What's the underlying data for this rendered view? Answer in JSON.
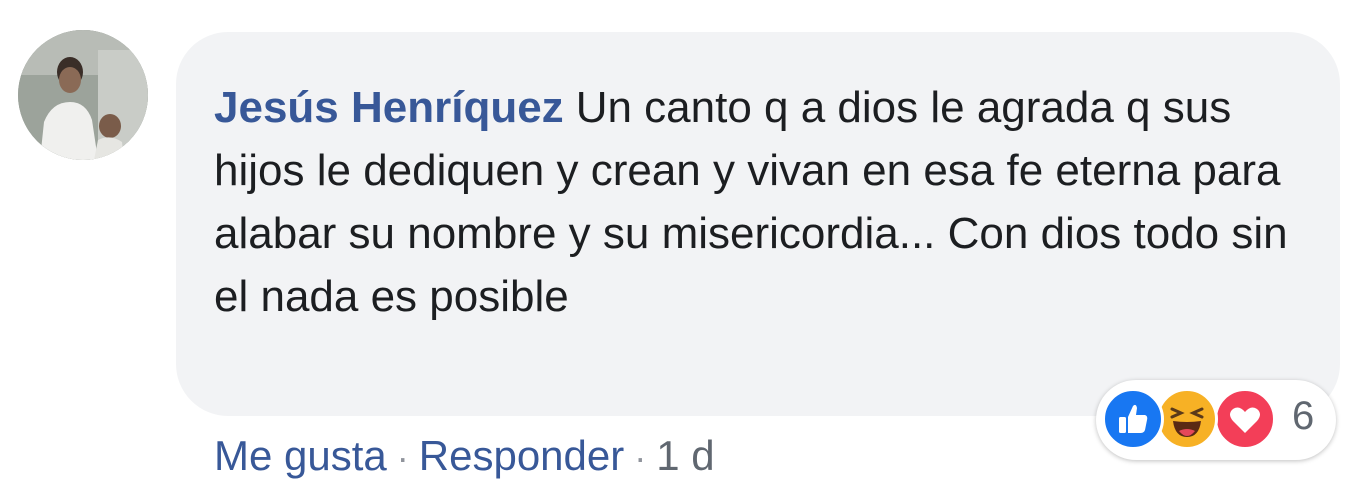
{
  "comment": {
    "author": "Jesús Henríquez",
    "text": "Un canto q a dios le agrada q sus hijos le dediquen y crean y vivan en esa fe eterna para alabar su nombre y su misericordia... Con dios todo sin el nada es posible"
  },
  "actions": {
    "like_label": "Me gusta",
    "reply_label": "Responder",
    "separator": "·",
    "time": "1 d"
  },
  "reactions": {
    "icons": [
      "like-icon",
      "haha-icon",
      "love-icon"
    ],
    "count": "6"
  },
  "colors": {
    "author": "#385898",
    "bubble": "#f2f3f5",
    "like": "#1877f2",
    "haha": "#f7b125",
    "love": "#f33e58"
  }
}
